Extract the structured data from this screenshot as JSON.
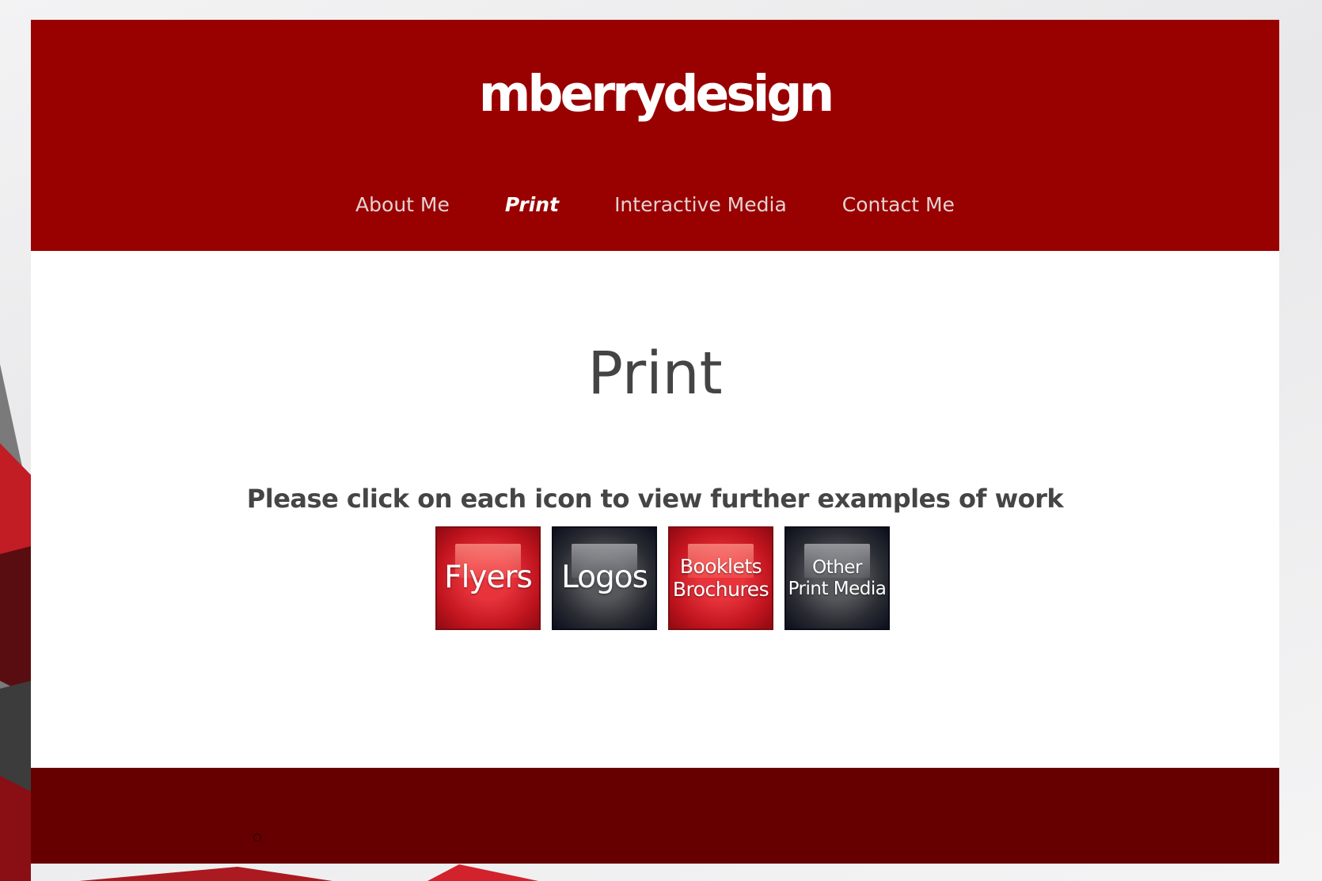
{
  "site": {
    "logo": "mberrydesign"
  },
  "nav": {
    "items": [
      {
        "label": "About Me"
      },
      {
        "label": "Print"
      },
      {
        "label": "Interactive Media"
      },
      {
        "label": "Contact Me"
      }
    ],
    "active": "Print"
  },
  "main": {
    "title": "Print",
    "subtitle": "Please click on each icon to view further examples of work",
    "icons": [
      {
        "lines": [
          "Flyers"
        ],
        "style": "red"
      },
      {
        "lines": [
          "Logos"
        ],
        "style": "dark"
      },
      {
        "lines": [
          "Booklets",
          "Brochures"
        ],
        "style": "red"
      },
      {
        "lines": [
          "Other",
          "Print Media"
        ],
        "style": "dark"
      }
    ]
  },
  "colors": {
    "header": "#990000",
    "footer": "#660000",
    "text": "#444444",
    "tile_red": "#c0141e",
    "tile_dark": "#0c0f1c"
  }
}
